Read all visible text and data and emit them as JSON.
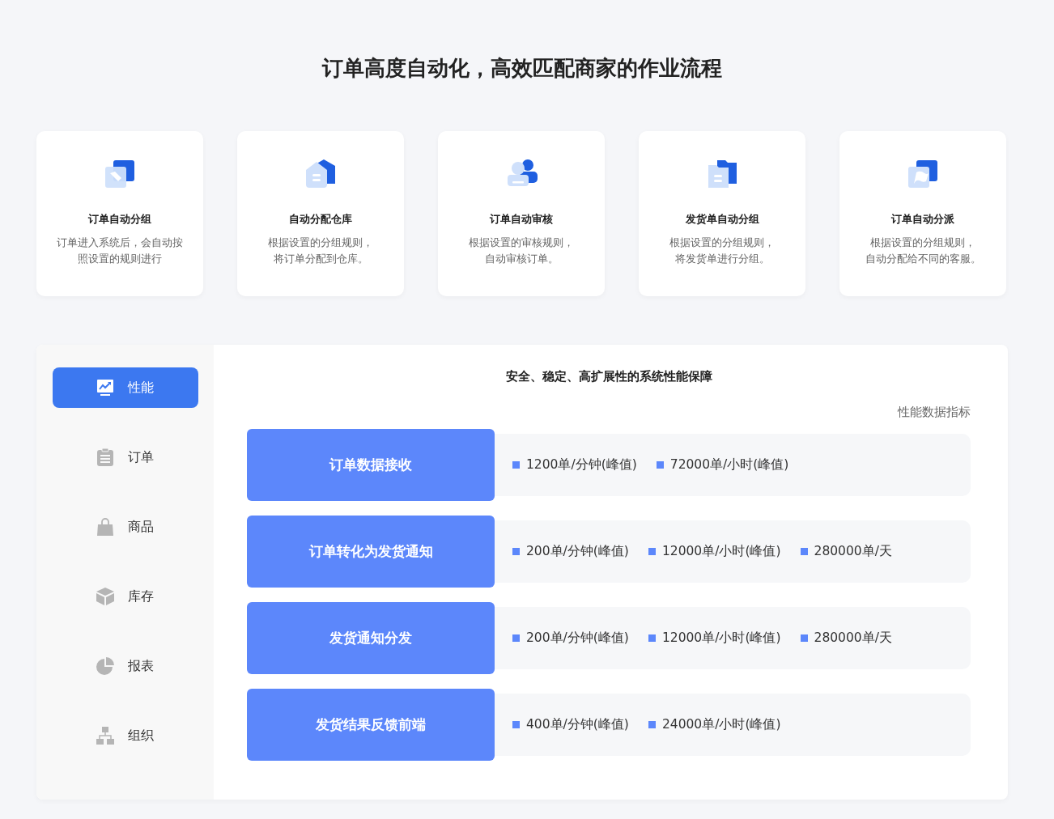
{
  "title": "订单高度自动化，高效匹配商家的作业流程",
  "features": [
    {
      "title": "订单自动分组",
      "description": [
        "订单进入系统后，会自动按",
        "照设置的规则进行"
      ]
    },
    {
      "title": "自动分配仓库",
      "description": [
        "根据设置的分组规则，",
        "将订单分配到仓库。"
      ]
    },
    {
      "title": "订单自动审核",
      "description": [
        "根据设置的审核规则，",
        "自动审核订单。"
      ]
    },
    {
      "title": "发货单自动分组",
      "description": [
        "根据设置的分组规则，",
        "将发货单进行分组。"
      ]
    },
    {
      "title": "订单自动分派",
      "description": [
        "根据设置的分组规则，",
        "自动分配给不同的客服。"
      ]
    }
  ],
  "sidebar": {
    "items": [
      {
        "label": "性能",
        "selected": true
      },
      {
        "label": "订单",
        "selected": false
      },
      {
        "label": "商品",
        "selected": false
      },
      {
        "label": "库存",
        "selected": false
      },
      {
        "label": "报表",
        "selected": false
      },
      {
        "label": "组织",
        "selected": false
      }
    ]
  },
  "panel": {
    "heading": "安全、稳定、高扩展性的系统性能保障",
    "caption": "性能数据指标",
    "rows": [
      {
        "label": "订单数据接收",
        "metrics": [
          "1200单/分钟(峰值)",
          "72000单/小时(峰值)"
        ]
      },
      {
        "label": "订单转化为发货通知",
        "metrics": [
          "200单/分钟(峰值)",
          "12000单/小时(峰值)",
          "280000单/天"
        ]
      },
      {
        "label": "发货通知分发",
        "metrics": [
          "200单/分钟(峰值)",
          "12000单/小时(峰值)",
          "280000单/天"
        ]
      },
      {
        "label": "发货结果反馈前端",
        "metrics": [
          "400单/分钟(峰值)",
          "24000单/小时(峰值)"
        ]
      }
    ]
  }
}
